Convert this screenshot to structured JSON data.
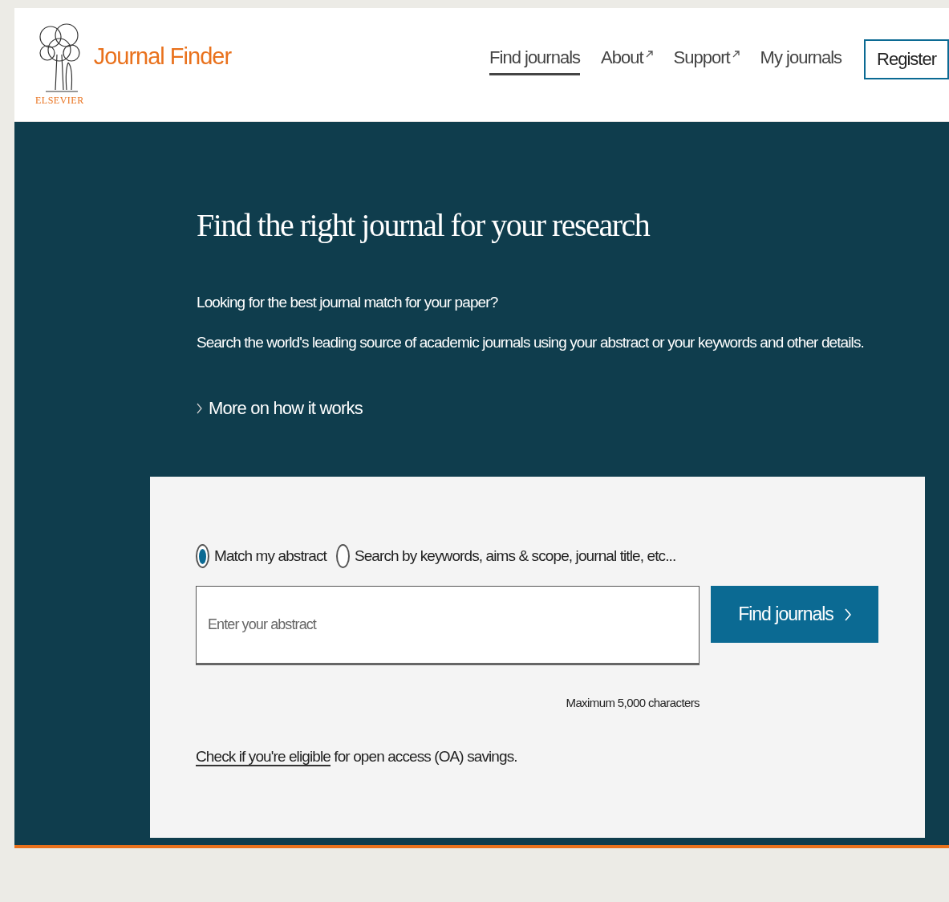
{
  "header": {
    "logo_text": "ELSEVIER",
    "title": "Journal Finder",
    "nav": [
      {
        "label": "Find journals",
        "selected": true,
        "external": false
      },
      {
        "label": "About",
        "selected": false,
        "external": true
      },
      {
        "label": "Support",
        "selected": false,
        "external": true
      },
      {
        "label": "My journals",
        "selected": false,
        "external": false
      }
    ],
    "register": "Register"
  },
  "hero": {
    "heading": "Find the right journal for your research",
    "lines": [
      "Looking for the best journal match for your paper?",
      "Search the world's leading source of academic journals using your abstract or your keywords and other details."
    ],
    "more_link": "More on how it works"
  },
  "search": {
    "modes": [
      {
        "label": "Match my abstract",
        "selected": true
      },
      {
        "label": "Search by keywords, aims & scope, journal title, etc...",
        "selected": false
      }
    ],
    "placeholder": "Enter your abstract",
    "button": "Find journals",
    "limit": "Maximum 5,000 characters",
    "oa_note": {
      "link": "Check if you're eligible",
      "rest": " for open access (OA) savings."
    }
  }
}
